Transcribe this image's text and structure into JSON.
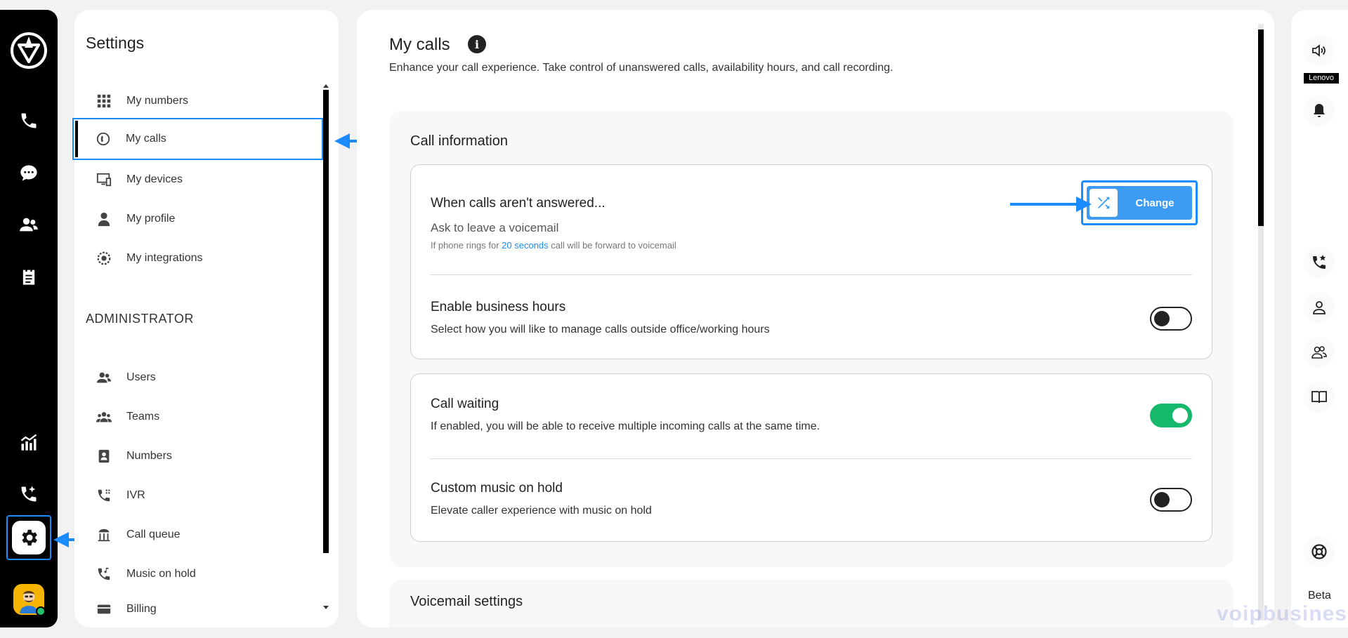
{
  "left_rail": {
    "icons": [
      "logo-icon",
      "phone-icon",
      "chat-icon",
      "contacts-icon",
      "notes-icon",
      "analytics-icon",
      "call-log-icon",
      "settings-icon",
      "avatar"
    ]
  },
  "settings": {
    "title": "Settings",
    "nav_items": [
      {
        "label": "My numbers",
        "icon": "dialpad-icon"
      },
      {
        "label": "My calls",
        "icon": "calls-icon",
        "active": true
      },
      {
        "label": "My devices",
        "icon": "devices-icon"
      },
      {
        "label": "My profile",
        "icon": "profile-icon"
      },
      {
        "label": "My integrations",
        "icon": "integrations-icon"
      }
    ],
    "admin_section": "ADMINISTRATOR",
    "admin_items": [
      {
        "label": "Users",
        "icon": "users-icon"
      },
      {
        "label": "Teams",
        "icon": "teams-icon"
      },
      {
        "label": "Numbers",
        "icon": "numbers-icon"
      },
      {
        "label": "IVR",
        "icon": "ivr-icon"
      },
      {
        "label": "Call queue",
        "icon": "call-queue-icon"
      },
      {
        "label": "Music on hold",
        "icon": "music-on-hold-icon"
      },
      {
        "label": "Billing",
        "icon": "billing-icon"
      }
    ]
  },
  "main": {
    "title": "My calls",
    "subtitle": "Enhance your call experience. Take control of unanswered calls, availability hours, and call recording.",
    "call_info": {
      "heading": "Call information",
      "unanswered": {
        "title": "When calls aren't answered...",
        "sub": "Ask to leave a voicemail",
        "note_prefix": "If phone rings for ",
        "note_highlight": "20 seconds",
        "note_suffix": " call will be forward to voicemail",
        "button_label": "Change"
      },
      "business_hours": {
        "title": "Enable business hours",
        "desc": "Select how you will like to manage calls outside office/working hours",
        "enabled": false
      },
      "call_waiting": {
        "title": "Call waiting",
        "desc": "If enabled, you will be able to receive multiple incoming calls at the same time.",
        "enabled": true
      },
      "music_on_hold": {
        "title": "Custom music on hold",
        "desc": "Elevate caller experience with music on hold",
        "enabled": false
      }
    },
    "voicemail_heading": "Voicemail settings"
  },
  "right_rail": {
    "device_label": "Lenovo",
    "beta_label": "Beta",
    "icons": [
      "speaker-icon",
      "bell-icon",
      "favorite-call-icon",
      "contact-icon",
      "group-icon",
      "book-icon",
      "support-icon"
    ]
  },
  "watermark": "voipbusiness",
  "colors": {
    "accent": "#1a8cff",
    "toggle_on": "#16b86b",
    "button": "#3d9bf3"
  }
}
